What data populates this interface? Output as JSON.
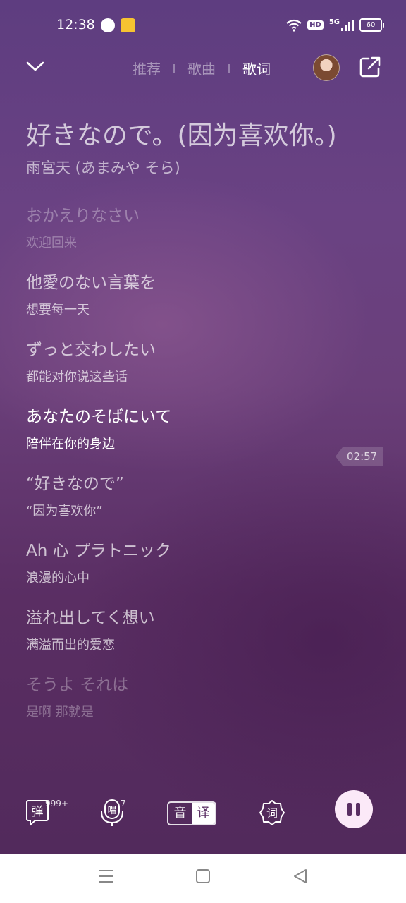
{
  "status_bar": {
    "time": "12:38",
    "network": "5G",
    "hd": "HD",
    "battery": "60"
  },
  "header": {
    "tabs": [
      {
        "label": "推荐",
        "active": false
      },
      {
        "label": "歌曲",
        "active": false
      },
      {
        "label": "歌词",
        "active": true
      }
    ]
  },
  "song": {
    "title": "好きなので。(因为喜欢你。)",
    "artist": "雨宮天 (あまみや そら)"
  },
  "lyrics": [
    {
      "jp": "おかえりなさい",
      "cn": "欢迎回来",
      "state": "dim"
    },
    {
      "jp": "他愛のない言葉を",
      "cn": "想要每一天",
      "state": "normal"
    },
    {
      "jp": "ずっと交わしたい",
      "cn": "都能对你说这些话",
      "state": "normal"
    },
    {
      "jp": "あなたのそばにいて",
      "cn": "陪伴在你的身边",
      "state": "active"
    },
    {
      "jp": "“好きなので”",
      "cn": "“因为喜欢你”",
      "state": "normal"
    },
    {
      "jp": "Ah 心 プラトニック",
      "cn": "浪漫的心中",
      "state": "normal"
    },
    {
      "jp": "溢れ出してく想い",
      "cn": "满溢而出的爱恋",
      "state": "normal"
    },
    {
      "jp": "そうよ それは",
      "cn": "是啊 那就是",
      "state": "dim"
    }
  ],
  "seek_time": "02:57",
  "controls": {
    "danmaku_label": "弹",
    "danmaku_count": "999+",
    "sing_label": "唱",
    "sing_count": "7",
    "sound_label": "音",
    "translate_label": "译",
    "lyric_style_label": "词"
  },
  "colors": {
    "background_top": "#5e3d80",
    "background_bottom": "#522a5c",
    "accent": "#fbe9f8"
  }
}
